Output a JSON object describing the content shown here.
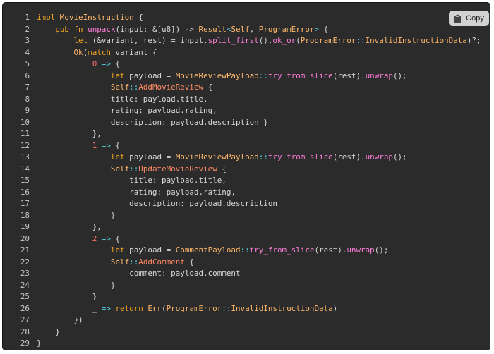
{
  "copy_button": {
    "label": "Copy",
    "icon": "clipboard-icon"
  },
  "colors": {
    "background": "#2b2b2b",
    "keyword": "#f5a623",
    "type": "#ffb86c",
    "function": "#ff7edb",
    "number": "#ff6e6e",
    "operator": "#56d4e6",
    "plain": "#d8d8d8"
  },
  "code": {
    "line_numbers": [
      "1",
      "2",
      "3",
      "4",
      "5",
      "6",
      "7",
      "8",
      "9",
      "10",
      "11",
      "12",
      "13",
      "14",
      "15",
      "16",
      "17",
      "18",
      "19",
      "20",
      "21",
      "22",
      "23",
      "24",
      "25",
      "26",
      "27",
      "28",
      "29"
    ],
    "lines": [
      [
        [
          "kw",
          "impl "
        ],
        [
          "ty",
          "MovieInstruction"
        ],
        [
          "pn",
          " {"
        ]
      ],
      [
        [
          "pn",
          "    "
        ],
        [
          "kw",
          "pub fn "
        ],
        [
          "fn",
          "unpack"
        ],
        [
          "pn",
          "(input: &[u8]) -> "
        ],
        [
          "ty",
          "Result"
        ],
        [
          "op",
          "<"
        ],
        [
          "ty",
          "Self"
        ],
        [
          "pn",
          ", "
        ],
        [
          "ty",
          "ProgramError"
        ],
        [
          "op",
          ">"
        ],
        [
          "pn",
          " {"
        ]
      ],
      [
        [
          "pn",
          "        "
        ],
        [
          "kw",
          "let "
        ],
        [
          "pn",
          "(&variant, rest) = input."
        ],
        [
          "fn",
          "split_first"
        ],
        [
          "pn",
          "()."
        ],
        [
          "fn",
          "ok_or"
        ],
        [
          "pn",
          "("
        ],
        [
          "ty",
          "ProgramError"
        ],
        [
          "op",
          "::"
        ],
        [
          "ty",
          "InvalidInstructionData"
        ],
        [
          "pn",
          ")?;"
        ]
      ],
      [
        [
          "pn",
          "        "
        ],
        [
          "ty",
          "Ok"
        ],
        [
          "pn",
          "("
        ],
        [
          "kw",
          "match "
        ],
        [
          "pn",
          "variant {"
        ]
      ],
      [
        [
          "pn",
          "            "
        ],
        [
          "cn",
          "0"
        ],
        [
          "op",
          " => "
        ],
        [
          "pn",
          "{"
        ]
      ],
      [
        [
          "pn",
          "                "
        ],
        [
          "kw",
          "let "
        ],
        [
          "pn",
          "payload = "
        ],
        [
          "ty",
          "MovieReviewPayload"
        ],
        [
          "op",
          "::"
        ],
        [
          "fn",
          "try_from_slice"
        ],
        [
          "pn",
          "(rest)."
        ],
        [
          "fn",
          "unwrap"
        ],
        [
          "pn",
          "();"
        ]
      ],
      [
        [
          "pn",
          "                "
        ],
        [
          "ty",
          "Self"
        ],
        [
          "op",
          "::"
        ],
        [
          "vr",
          "AddMovieReview"
        ],
        [
          "pn",
          " {"
        ]
      ],
      [
        [
          "pn",
          "                title: payload.title,"
        ]
      ],
      [
        [
          "pn",
          "                rating: payload.rating,"
        ]
      ],
      [
        [
          "pn",
          "                description: payload.description }"
        ]
      ],
      [
        [
          "pn",
          "            },"
        ]
      ],
      [
        [
          "pn",
          "            "
        ],
        [
          "cn",
          "1"
        ],
        [
          "op",
          " => "
        ],
        [
          "pn",
          "{"
        ]
      ],
      [
        [
          "pn",
          "                "
        ],
        [
          "kw",
          "let "
        ],
        [
          "pn",
          "payload = "
        ],
        [
          "ty",
          "MovieReviewPayload"
        ],
        [
          "op",
          "::"
        ],
        [
          "fn",
          "try_from_slice"
        ],
        [
          "pn",
          "(rest)."
        ],
        [
          "fn",
          "unwrap"
        ],
        [
          "pn",
          "();"
        ]
      ],
      [
        [
          "pn",
          "                "
        ],
        [
          "ty",
          "Self"
        ],
        [
          "op",
          "::"
        ],
        [
          "vr",
          "UpdateMovieReview"
        ],
        [
          "pn",
          " {"
        ]
      ],
      [
        [
          "pn",
          "                    title: payload.title,"
        ]
      ],
      [
        [
          "pn",
          "                    rating: payload.rating,"
        ]
      ],
      [
        [
          "pn",
          "                    description: payload.description"
        ]
      ],
      [
        [
          "pn",
          "                }"
        ]
      ],
      [
        [
          "pn",
          "            },"
        ]
      ],
      [
        [
          "pn",
          "            "
        ],
        [
          "cn",
          "2"
        ],
        [
          "op",
          " => "
        ],
        [
          "pn",
          "{"
        ]
      ],
      [
        [
          "pn",
          "                "
        ],
        [
          "kw",
          "let "
        ],
        [
          "pn",
          "payload = "
        ],
        [
          "ty",
          "CommentPayload"
        ],
        [
          "op",
          "::"
        ],
        [
          "fn",
          "try_from_slice"
        ],
        [
          "pn",
          "(rest)."
        ],
        [
          "fn",
          "unwrap"
        ],
        [
          "pn",
          "();"
        ]
      ],
      [
        [
          "pn",
          "                "
        ],
        [
          "ty",
          "Self"
        ],
        [
          "op",
          "::"
        ],
        [
          "vr",
          "AddComment"
        ],
        [
          "pn",
          " {"
        ]
      ],
      [
        [
          "pn",
          "                    comment: payload.comment"
        ]
      ],
      [
        [
          "pn",
          "                }"
        ]
      ],
      [
        [
          "pn",
          "            }"
        ]
      ],
      [
        [
          "pn",
          "            _ "
        ],
        [
          "op",
          "=> "
        ],
        [
          "kw",
          "return "
        ],
        [
          "ty",
          "Err"
        ],
        [
          "pn",
          "("
        ],
        [
          "ty",
          "ProgramError"
        ],
        [
          "op",
          "::"
        ],
        [
          "ty",
          "InvalidInstructionData"
        ],
        [
          "pn",
          ")"
        ]
      ],
      [
        [
          "pn",
          "        })"
        ]
      ],
      [
        [
          "pn",
          "    }"
        ]
      ],
      [
        [
          "pn",
          "}"
        ]
      ]
    ]
  }
}
